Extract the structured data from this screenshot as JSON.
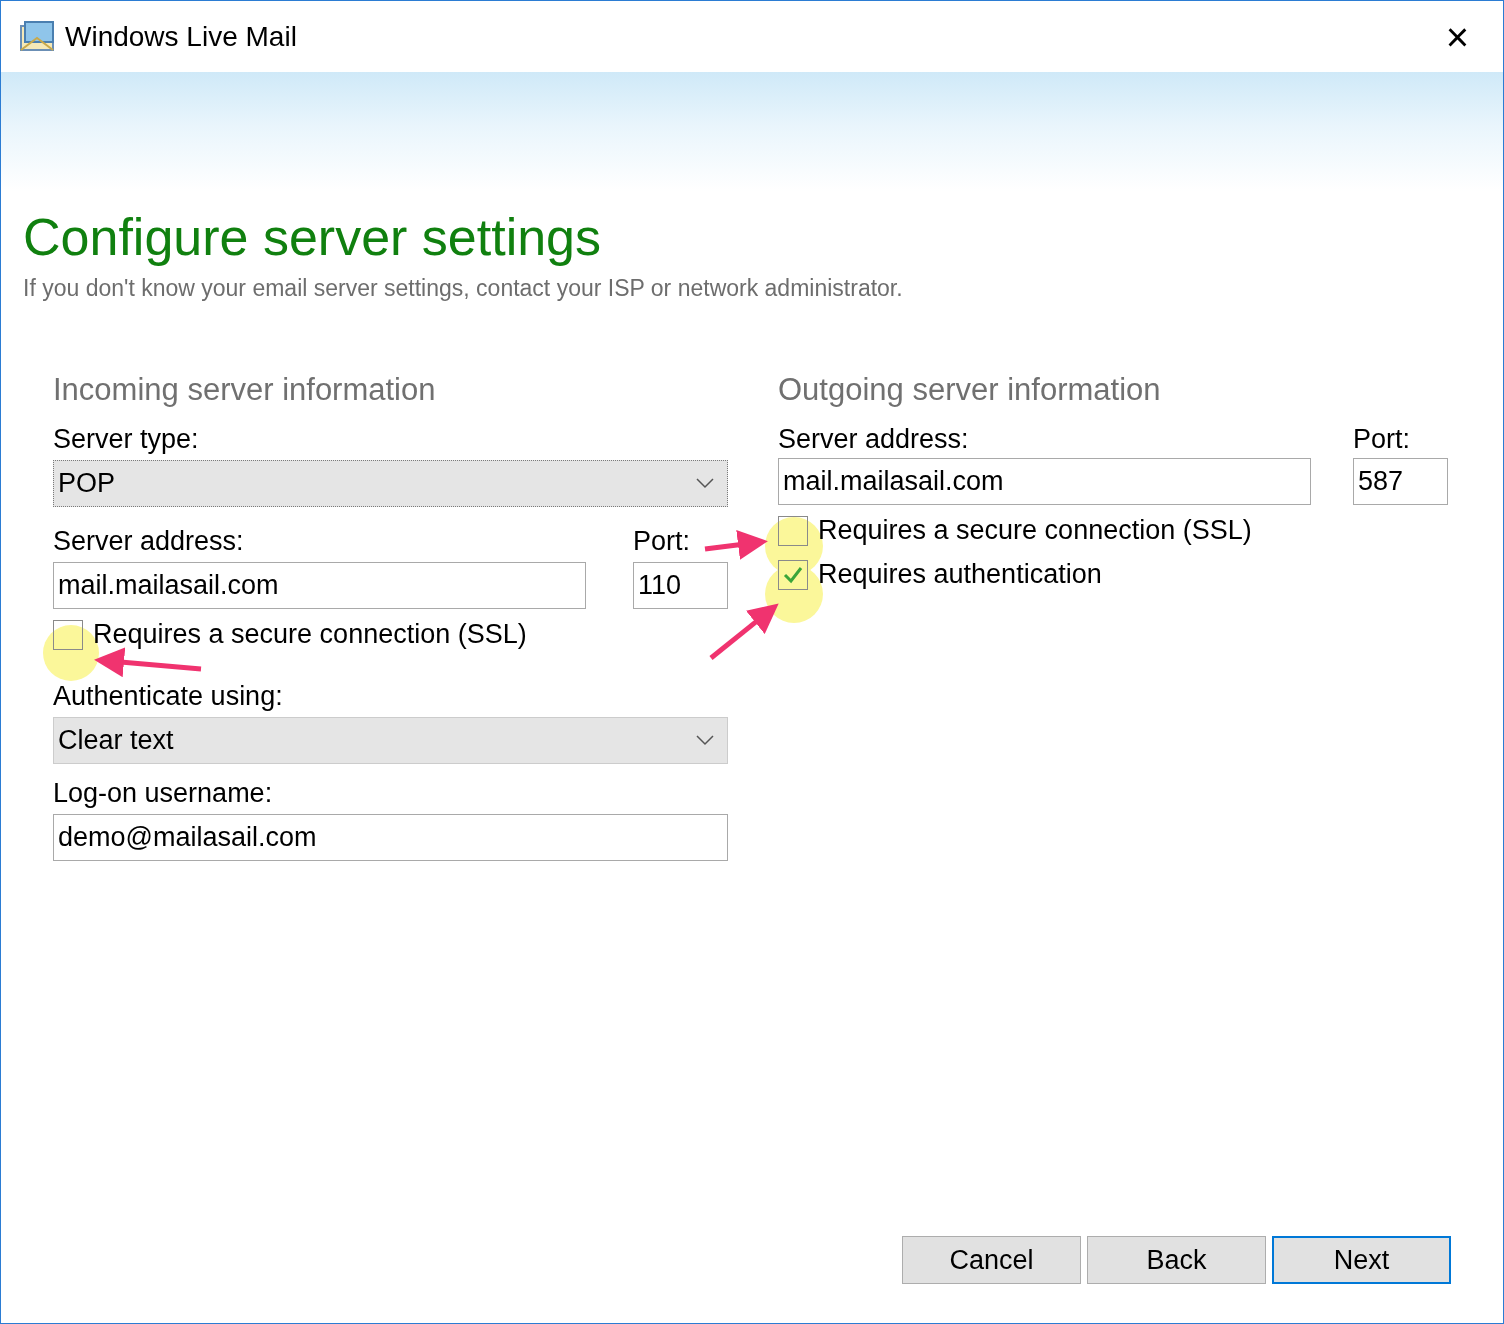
{
  "window": {
    "title": "Windows Live Mail",
    "close": "×"
  },
  "heading": "Configure server settings",
  "subtitle": "If you don't know your email server settings, contact your ISP or network administrator.",
  "incoming": {
    "section_title": "Incoming server information",
    "server_type_label": "Server type:",
    "server_type": "POP",
    "server_address_label": "Server address:",
    "server_address": "mail.mailasail.com",
    "port_label": "Port:",
    "port": "110",
    "checkboxes": [
      {
        "label": "Requires a secure connection (SSL)",
        "checked": false
      }
    ],
    "auth_label": "Authenticate using:",
    "auth": "Clear text",
    "username_label": "Log-on username:",
    "username": "demo@mailasail.com"
  },
  "outgoing": {
    "section_title": "Outgoing server information",
    "server_address_label": "Server address:",
    "server_address": "mail.mailasail.com",
    "port_label": "Port:",
    "port": "587",
    "checkboxes": [
      {
        "label": "Requires a secure connection (SSL)",
        "checked": false
      },
      {
        "label": "Requires authentication",
        "checked": true
      }
    ]
  },
  "buttons": [
    {
      "label": "Cancel",
      "selected": false
    },
    {
      "label": "Back",
      "selected": false
    },
    {
      "label": "Next",
      "selected": true
    }
  ]
}
